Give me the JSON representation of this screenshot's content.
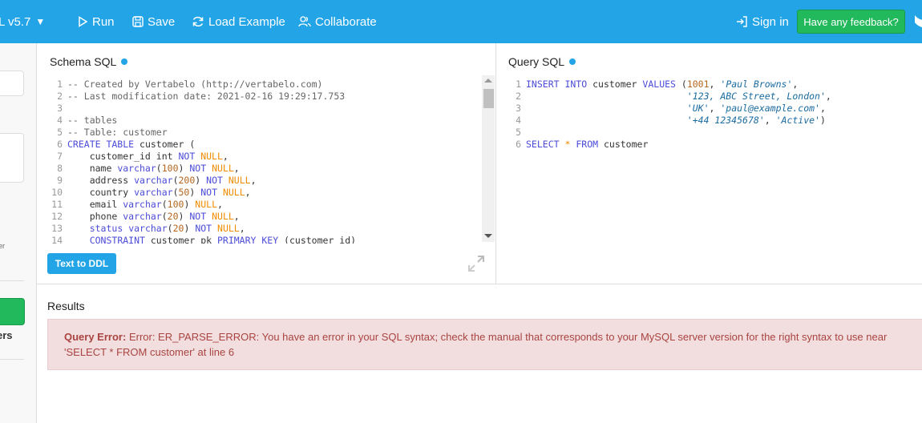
{
  "topbar": {
    "db_version": "L v5.7",
    "run": "Run",
    "save": "Save",
    "load_example": "Load Example",
    "collaborate": "Collaborate",
    "sign_in": "Sign in",
    "feedback": "Have any feedback?"
  },
  "sidebar": {
    "tiny_text": "er",
    "label": "ers"
  },
  "schema": {
    "title": "Schema SQL",
    "button": "Text to DDL"
  },
  "query": {
    "title": "Query SQL"
  },
  "results": {
    "title": "Results",
    "error_label": "Query Error:",
    "error_message": "Error: ER_PARSE_ERROR: You have an error in your SQL syntax; check the manual that corresponds to your MySQL server version for the right syntax to use near 'SELECT * FROM customer' at line 6"
  },
  "schema_lines": [
    {
      "n": "1",
      "tokens": [
        [
          "cm",
          "-- Created by Vertabelo (http://vertabelo.com)"
        ]
      ]
    },
    {
      "n": "2",
      "tokens": [
        [
          "cm",
          "-- Last modification date: 2021-02-16 19:29:17.753"
        ]
      ]
    },
    {
      "n": "3",
      "tokens": []
    },
    {
      "n": "4",
      "tokens": [
        [
          "cm",
          "-- tables"
        ]
      ]
    },
    {
      "n": "5",
      "tokens": [
        [
          "cm",
          "-- Table: customer"
        ]
      ]
    },
    {
      "n": "6",
      "tokens": [
        [
          "kw",
          "CREATE TABLE"
        ],
        [
          "",
          " customer ("
        ]
      ]
    },
    {
      "n": "7",
      "tokens": [
        [
          "",
          "    customer_id int "
        ],
        [
          "kw",
          "NOT"
        ],
        [
          "",
          " "
        ],
        [
          "nl",
          "NULL"
        ],
        [
          "",
          ","
        ]
      ]
    },
    {
      "n": "8",
      "tokens": [
        [
          "",
          "    name "
        ],
        [
          "kw",
          "varchar"
        ],
        [
          "",
          "("
        ],
        [
          "num",
          "100"
        ],
        [
          "",
          ") "
        ],
        [
          "kw",
          "NOT"
        ],
        [
          "",
          " "
        ],
        [
          "nl",
          "NULL"
        ],
        [
          "",
          ","
        ]
      ]
    },
    {
      "n": "9",
      "tokens": [
        [
          "",
          "    address "
        ],
        [
          "kw",
          "varchar"
        ],
        [
          "",
          "("
        ],
        [
          "num",
          "200"
        ],
        [
          "",
          ") "
        ],
        [
          "kw",
          "NOT"
        ],
        [
          "",
          " "
        ],
        [
          "nl",
          "NULL"
        ],
        [
          "",
          ","
        ]
      ]
    },
    {
      "n": "10",
      "tokens": [
        [
          "",
          "    country "
        ],
        [
          "kw",
          "varchar"
        ],
        [
          "",
          "("
        ],
        [
          "num",
          "50"
        ],
        [
          "",
          ") "
        ],
        [
          "kw",
          "NOT"
        ],
        [
          "",
          " "
        ],
        [
          "nl",
          "NULL"
        ],
        [
          "",
          ","
        ]
      ]
    },
    {
      "n": "11",
      "tokens": [
        [
          "",
          "    email "
        ],
        [
          "kw",
          "varchar"
        ],
        [
          "",
          "("
        ],
        [
          "num",
          "100"
        ],
        [
          "",
          ") "
        ],
        [
          "nl",
          "NULL"
        ],
        [
          "",
          ","
        ]
      ]
    },
    {
      "n": "12",
      "tokens": [
        [
          "",
          "    phone "
        ],
        [
          "kw",
          "varchar"
        ],
        [
          "",
          "("
        ],
        [
          "num",
          "20"
        ],
        [
          "",
          ") "
        ],
        [
          "kw",
          "NOT"
        ],
        [
          "",
          " "
        ],
        [
          "nl",
          "NULL"
        ],
        [
          "",
          ","
        ]
      ]
    },
    {
      "n": "13",
      "tokens": [
        [
          "",
          "    "
        ],
        [
          "var",
          "status"
        ],
        [
          "",
          " "
        ],
        [
          "kw",
          "varchar"
        ],
        [
          "",
          "("
        ],
        [
          "num",
          "20"
        ],
        [
          "",
          ") "
        ],
        [
          "kw",
          "NOT"
        ],
        [
          "",
          " "
        ],
        [
          "nl",
          "NULL"
        ],
        [
          "",
          ","
        ]
      ]
    },
    {
      "n": "14",
      "tokens": [
        [
          "",
          "    "
        ],
        [
          "kw",
          "CONSTRAINT"
        ],
        [
          "",
          " customer_pk "
        ],
        [
          "kw",
          "PRIMARY KEY"
        ],
        [
          "",
          " (customer_id)"
        ]
      ]
    }
  ],
  "query_lines": [
    {
      "n": "1",
      "tokens": [
        [
          "kw",
          "INSERT INTO"
        ],
        [
          "",
          " customer "
        ],
        [
          "kw",
          "VALUES"
        ],
        [
          "",
          " ("
        ],
        [
          "num",
          "1001"
        ],
        [
          "",
          ", "
        ],
        [
          "str",
          "'Paul Browns'"
        ],
        [
          "",
          ","
        ]
      ]
    },
    {
      "n": "2",
      "tokens": [
        [
          "",
          "                             "
        ],
        [
          "str",
          "'123, ABC Street, London'"
        ],
        [
          "",
          ","
        ]
      ]
    },
    {
      "n": "3",
      "tokens": [
        [
          "",
          "                             "
        ],
        [
          "str",
          "'UK'"
        ],
        [
          "",
          ", "
        ],
        [
          "str",
          "'paul@example.com'"
        ],
        [
          "",
          ","
        ]
      ]
    },
    {
      "n": "4",
      "tokens": [
        [
          "",
          "                             "
        ],
        [
          "str",
          "'+44 12345678'"
        ],
        [
          "",
          ", "
        ],
        [
          "str",
          "'Active'"
        ],
        [
          "",
          ")"
        ]
      ]
    },
    {
      "n": "5",
      "tokens": []
    },
    {
      "n": "6",
      "tokens": [
        [
          "kw",
          "SELECT"
        ],
        [
          "",
          " "
        ],
        [
          "nl",
          "*"
        ],
        [
          "",
          " "
        ],
        [
          "kw",
          "FROM"
        ],
        [
          "",
          " customer"
        ]
      ]
    }
  ]
}
